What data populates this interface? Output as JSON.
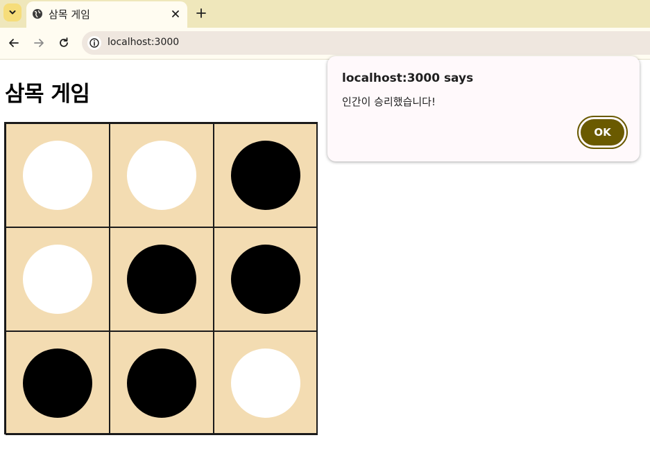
{
  "browser": {
    "tab": {
      "title": "삼목 게임"
    },
    "address_bar": {
      "url": "localhost:3000"
    },
    "icons": {
      "tab_menu": "chevron-down-icon",
      "favicon": "globe-icon",
      "close": "close-icon",
      "new_tab": "plus-icon",
      "back": "back-arrow-icon",
      "forward": "forward-arrow-icon",
      "reload": "reload-icon",
      "site_info": "info-icon"
    }
  },
  "page": {
    "title": "삼목 게임",
    "board": {
      "rows": 3,
      "cols": 3,
      "cells": [
        "white",
        "white",
        "black",
        "white",
        "black",
        "black",
        "black",
        "black",
        "white"
      ],
      "colors": {
        "board": "#f3dcb2",
        "white_stone": "#ffffff",
        "black_stone": "#000000",
        "grid": "#1a1a1a"
      }
    }
  },
  "dialog": {
    "title": "localhost:3000 says",
    "message": "인간이 승리했습니다!",
    "ok_label": "OK",
    "accent_color": "#6a5a00"
  }
}
